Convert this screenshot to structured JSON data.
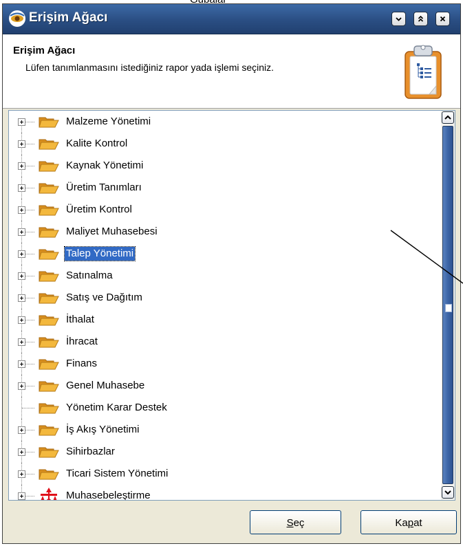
{
  "background_fragment": "Gubalar",
  "window": {
    "title": "Erişim Ağacı",
    "buttons": [
      {
        "name": "minimize",
        "icon": "chevron-down-icon"
      },
      {
        "name": "maximize",
        "icon": "double-chevron-up-icon"
      },
      {
        "name": "close",
        "icon": "close-icon"
      }
    ]
  },
  "header": {
    "title": "Erişim Ağacı",
    "subtitle": "Lüfen tanımlanmasını istediğiniz rapor yada işlemi seçiniz.",
    "icon": "clipboard-tree-icon"
  },
  "tree": {
    "items": [
      {
        "label": "Malzeme Yönetimi",
        "expandable": true,
        "icon": "folder-icon"
      },
      {
        "label": "Kalite Kontrol",
        "expandable": true,
        "icon": "folder-icon"
      },
      {
        "label": "Kaynak Yönetimi",
        "expandable": true,
        "icon": "folder-icon"
      },
      {
        "label": "Üretim Tanımları",
        "expandable": true,
        "icon": "folder-icon"
      },
      {
        "label": "Üretim Kontrol",
        "expandable": true,
        "icon": "folder-icon"
      },
      {
        "label": "Maliyet Muhasebesi",
        "expandable": true,
        "icon": "folder-icon"
      },
      {
        "label": "Talep Yönetimi",
        "expandable": true,
        "icon": "folder-icon",
        "selected": true
      },
      {
        "label": "Satınalma",
        "expandable": true,
        "icon": "folder-icon"
      },
      {
        "label": "Satış ve Dağıtım",
        "expandable": true,
        "icon": "folder-icon"
      },
      {
        "label": "İthalat",
        "expandable": true,
        "icon": "folder-icon"
      },
      {
        "label": "İhracat",
        "expandable": true,
        "icon": "folder-icon"
      },
      {
        "label": "Finans",
        "expandable": true,
        "icon": "folder-icon"
      },
      {
        "label": "Genel Muhasebe",
        "expandable": true,
        "icon": "folder-icon"
      },
      {
        "label": "Yönetim Karar Destek",
        "expandable": false,
        "icon": "folder-icon"
      },
      {
        "label": "İş Akış Yönetimi",
        "expandable": true,
        "icon": "folder-icon"
      },
      {
        "label": "Sihirbazlar",
        "expandable": true,
        "icon": "folder-icon"
      },
      {
        "label": "Ticari Sistem Yönetimi",
        "expandable": true,
        "icon": "folder-icon"
      },
      {
        "label": "Muhasebeleştirme",
        "expandable": true,
        "icon": "red-network-icon"
      }
    ]
  },
  "footer": {
    "select_button": {
      "pre": "",
      "accel": "S",
      "post": "eç"
    },
    "close_button": {
      "pre": "Ka",
      "accel": "p",
      "post": "at"
    }
  },
  "colors": {
    "titlebar": "#2f568f",
    "selection": "#316ac5",
    "folder": "#f3b83d",
    "scroll_thumb": "#3d65a6"
  }
}
